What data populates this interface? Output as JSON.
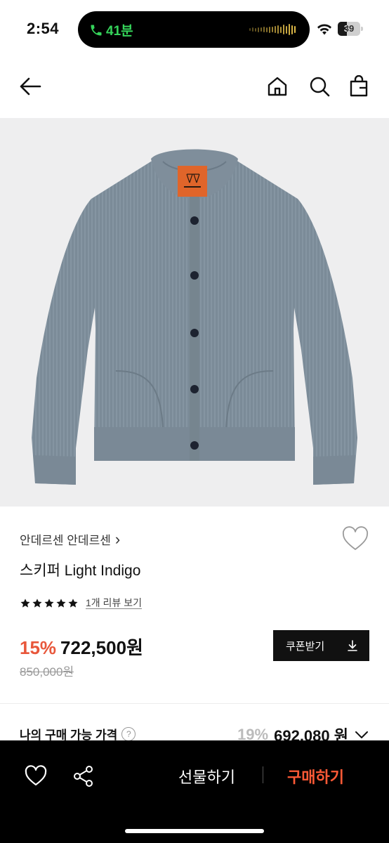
{
  "status": {
    "time": "2:54",
    "call_time": "41분",
    "battery": "39",
    "wave_levels": [
      4,
      6,
      5,
      7,
      6,
      8,
      7,
      9,
      8,
      10,
      12,
      9,
      14,
      11,
      16,
      13,
      10
    ]
  },
  "nav": {
    "back_icon": "arrow-left-icon",
    "home_icon": "home-icon",
    "search_icon": "search-icon",
    "bag_icon": "shopping-bag-icon"
  },
  "product": {
    "brand": "안데르센 안데르센",
    "brand_chevron": "›",
    "title": "스키퍼 Light Indigo",
    "stars": 5,
    "review_link": "1개 리뷰 보기",
    "discount": "15%",
    "price": "722,500원",
    "original_price": "850,000원",
    "coupon_label": "쿠폰받기",
    "image_colors": {
      "background": "#eeeeef",
      "knit": "#7a8a97",
      "label": "#e0652a"
    }
  },
  "my_price": {
    "label": "나의 구매 가능 가격",
    "help": "?",
    "discount": "19%",
    "price": "692,080 원"
  },
  "bottom": {
    "gift_label": "선물하기",
    "buy_label": "구매하기"
  },
  "colors": {
    "accent": "#e8573b",
    "buy": "#ff5a36",
    "call_green": "#35d35a"
  }
}
